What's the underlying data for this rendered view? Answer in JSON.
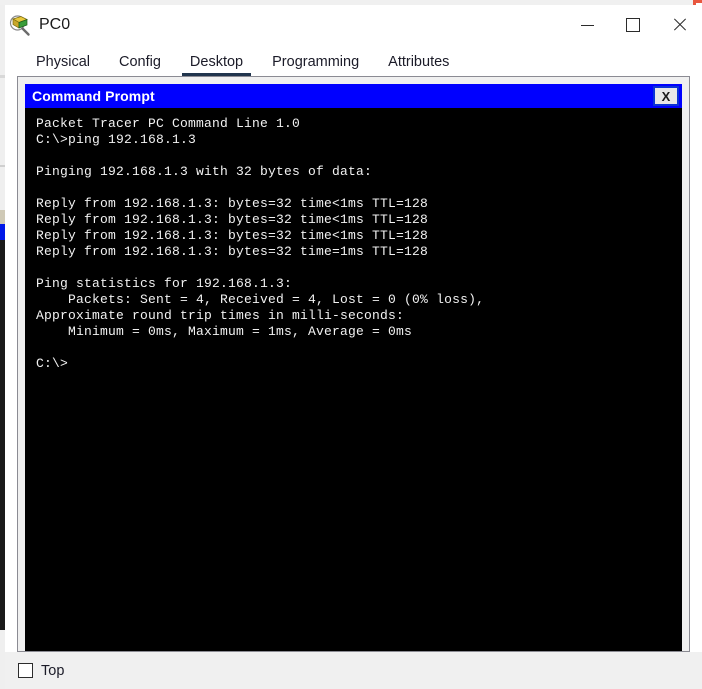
{
  "background_window": {
    "occluded_title_text": "",
    "accent_color": "#e8573f"
  },
  "window": {
    "title": "PC0",
    "icon": "packet-tracer-pc-icon",
    "controls": {
      "minimize": "—",
      "maximize": "□",
      "close": "✕"
    }
  },
  "tabs": [
    {
      "label": "Physical",
      "active": false
    },
    {
      "label": "Config",
      "active": false
    },
    {
      "label": "Desktop",
      "active": true
    },
    {
      "label": "Programming",
      "active": false
    },
    {
      "label": "Attributes",
      "active": false
    }
  ],
  "command_prompt": {
    "title": "Command Prompt",
    "close_label": "X",
    "title_bar_color": "#0000ff",
    "title_text_color": "#ffffff",
    "terminal_bg": "#000000",
    "terminal_fg": "#f2f2f2",
    "lines": [
      "Packet Tracer PC Command Line 1.0",
      "C:\\>ping 192.168.1.3",
      "",
      "Pinging 192.168.1.3 with 32 bytes of data:",
      "",
      "Reply from 192.168.1.3: bytes=32 time<1ms TTL=128",
      "Reply from 192.168.1.3: bytes=32 time<1ms TTL=128",
      "Reply from 192.168.1.3: bytes=32 time<1ms TTL=128",
      "Reply from 192.168.1.3: bytes=32 time=1ms TTL=128",
      "",
      "Ping statistics for 192.168.1.3:",
      "    Packets: Sent = 4, Received = 4, Lost = 0 (0% loss),",
      "Approximate round trip times in milli-seconds:",
      "    Minimum = 0ms, Maximum = 1ms, Average = 0ms",
      "",
      "C:\\>"
    ]
  },
  "bottom": {
    "top_checkbox_label": "Top",
    "top_checkbox_checked": false
  }
}
